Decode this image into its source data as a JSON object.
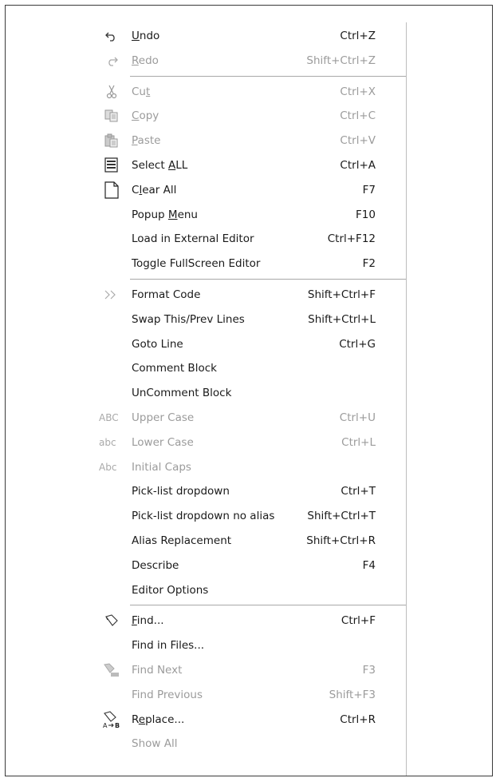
{
  "menu": {
    "sections": [
      [
        {
          "label": "Undo",
          "ul": 0,
          "shortcut": "Ctrl+Z",
          "icon": "undo-icon",
          "enabled": true
        },
        {
          "label": "Redo",
          "ul": 0,
          "shortcut": "Shift+Ctrl+Z",
          "icon": "redo-icon",
          "enabled": false
        }
      ],
      [
        {
          "label": "Cut",
          "ul": 2,
          "shortcut": "Ctrl+X",
          "icon": "cut-icon",
          "enabled": false
        },
        {
          "label": "Copy",
          "ul": 0,
          "shortcut": "Ctrl+C",
          "icon": "copy-icon",
          "enabled": false
        },
        {
          "label": "Paste",
          "ul": 0,
          "shortcut": "Ctrl+V",
          "icon": "paste-icon",
          "enabled": false
        },
        {
          "label": "Select ALL",
          "ul": 7,
          "shortcut": "Ctrl+A",
          "icon": "select-all-icon",
          "enabled": true
        },
        {
          "label": "Clear All",
          "ul": 1,
          "shortcut": "F7",
          "icon": "clear-all-icon",
          "enabled": true
        },
        {
          "label": "Popup Menu",
          "ul": 6,
          "shortcut": "F10",
          "icon": "",
          "enabled": true
        },
        {
          "label": "Load in External Editor",
          "ul": -1,
          "shortcut": "Ctrl+F12",
          "icon": "",
          "enabled": true
        },
        {
          "label": "Toggle FullScreen Editor",
          "ul": -1,
          "shortcut": "F2",
          "icon": "",
          "enabled": true
        }
      ],
      [
        {
          "label": "Format Code",
          "ul": -1,
          "shortcut": "Shift+Ctrl+F",
          "icon": "format-code-icon",
          "enabled": true
        },
        {
          "label": "Swap This/Prev Lines",
          "ul": -1,
          "shortcut": "Shift+Ctrl+L",
          "icon": "",
          "enabled": true
        },
        {
          "label": "Goto Line",
          "ul": -1,
          "shortcut": "Ctrl+G",
          "icon": "",
          "enabled": true
        },
        {
          "label": "Comment Block",
          "ul": -1,
          "shortcut": "",
          "icon": "",
          "enabled": true
        },
        {
          "label": "UnComment Block",
          "ul": -1,
          "shortcut": "",
          "icon": "",
          "enabled": true
        },
        {
          "label": "Upper Case",
          "ul": -1,
          "shortcut": "Ctrl+U",
          "icon": "upper-case-icon",
          "icon_text": "ABC",
          "enabled": false
        },
        {
          "label": "Lower Case",
          "ul": -1,
          "shortcut": "Ctrl+L",
          "icon": "lower-case-icon",
          "icon_text": "abc",
          "enabled": false
        },
        {
          "label": "Initial Caps",
          "ul": -1,
          "shortcut": "",
          "icon": "initial-caps-icon",
          "icon_text": "Abc",
          "enabled": false
        },
        {
          "label": "Pick-list dropdown",
          "ul": -1,
          "shortcut": "Ctrl+T",
          "icon": "",
          "enabled": true
        },
        {
          "label": "Pick-list dropdown no alias",
          "ul": -1,
          "shortcut": "Shift+Ctrl+T",
          "icon": "",
          "enabled": true
        },
        {
          "label": "Alias Replacement",
          "ul": -1,
          "shortcut": "Shift+Ctrl+R",
          "icon": "",
          "enabled": true
        },
        {
          "label": "Describe",
          "ul": -1,
          "shortcut": "F4",
          "icon": "",
          "enabled": true
        },
        {
          "label": "Editor Options",
          "ul": -1,
          "shortcut": "",
          "icon": "",
          "enabled": true
        }
      ],
      [
        {
          "label": "Find...",
          "ul": 0,
          "shortcut": "Ctrl+F",
          "icon": "find-icon",
          "enabled": true
        },
        {
          "label": "Find in Files...",
          "ul": -1,
          "shortcut": "",
          "icon": "",
          "enabled": true
        },
        {
          "label": "Find Next",
          "ul": -1,
          "shortcut": "F3",
          "icon": "find-next-icon",
          "enabled": false
        },
        {
          "label": "Find Previous",
          "ul": -1,
          "shortcut": "Shift+F3",
          "icon": "",
          "enabled": false
        },
        {
          "label": "Replace...",
          "ul": 1,
          "shortcut": "Ctrl+R",
          "icon": "replace-icon",
          "enabled": true
        },
        {
          "label": "Show All",
          "ul": -1,
          "shortcut": "",
          "icon": "",
          "enabled": false
        }
      ]
    ]
  }
}
